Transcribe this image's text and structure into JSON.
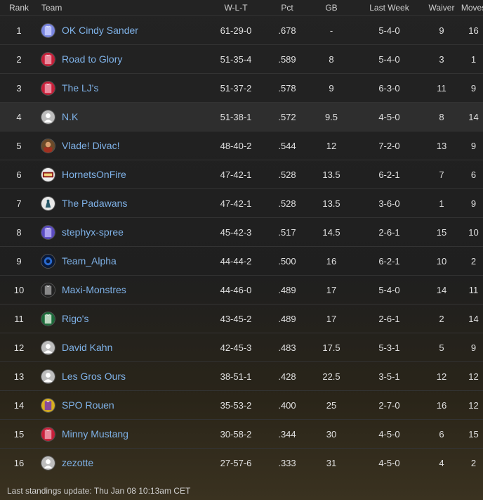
{
  "headers": {
    "rank": "Rank",
    "team": "Team",
    "wlt": "W-L-T",
    "pct": "Pct",
    "gb": "GB",
    "last_week": "Last Week",
    "waiver": "Waiver",
    "moves": "Moves"
  },
  "rows": [
    {
      "rank": "1",
      "team": "OK Cindy Sander",
      "wlt": "61-29-0",
      "pct": ".678",
      "gb": "-",
      "last_week": "5-4-0",
      "waiver": "9",
      "moves": "16",
      "logo": "jersey-blue-icon"
    },
    {
      "rank": "2",
      "team": "Road to Glory",
      "wlt": "51-35-4",
      "pct": ".589",
      "gb": "8",
      "last_week": "5-4-0",
      "waiver": "3",
      "moves": "1",
      "logo": "jersey-red-icon"
    },
    {
      "rank": "3",
      "team": "The LJ's",
      "wlt": "51-37-2",
      "pct": ".578",
      "gb": "9",
      "last_week": "6-3-0",
      "waiver": "11",
      "moves": "9",
      "logo": "jersey-red-icon"
    },
    {
      "rank": "4",
      "team": "N.K",
      "wlt": "51-38-1",
      "pct": ".572",
      "gb": "9.5",
      "last_week": "4-5-0",
      "waiver": "8",
      "moves": "14",
      "logo": "default-avatar-icon"
    },
    {
      "rank": "5",
      "team": "Vlade! Divac!",
      "wlt": "48-40-2",
      "pct": ".544",
      "gb": "12",
      "last_week": "7-2-0",
      "waiver": "13",
      "moves": "9",
      "logo": "photo-avatar-icon"
    },
    {
      "rank": "6",
      "team": "HornetsOnFire",
      "wlt": "47-42-1",
      "pct": ".528",
      "gb": "13.5",
      "last_week": "6-2-1",
      "waiver": "7",
      "moves": "6",
      "logo": "team-logo-icon"
    },
    {
      "rank": "7",
      "team": "The Padawans",
      "wlt": "47-42-1",
      "pct": ".528",
      "gb": "13.5",
      "last_week": "3-6-0",
      "waiver": "1",
      "moves": "9",
      "logo": "padawan-logo-icon"
    },
    {
      "rank": "8",
      "team": "stephyx-spree",
      "wlt": "45-42-3",
      "pct": ".517",
      "gb": "14.5",
      "last_week": "2-6-1",
      "waiver": "15",
      "moves": "10",
      "logo": "jersey-purple-icon"
    },
    {
      "rank": "9",
      "team": "Team_Alpha",
      "wlt": "44-44-2",
      "pct": ".500",
      "gb": "16",
      "last_week": "6-2-1",
      "waiver": "10",
      "moves": "2",
      "logo": "alpha-logo-icon"
    },
    {
      "rank": "10",
      "team": "Maxi-Monstres",
      "wlt": "44-46-0",
      "pct": ".489",
      "gb": "17",
      "last_week": "5-4-0",
      "waiver": "14",
      "moves": "11",
      "logo": "jersey-black-icon"
    },
    {
      "rank": "11",
      "team": "Rigo's",
      "wlt": "43-45-2",
      "pct": ".489",
      "gb": "17",
      "last_week": "2-6-1",
      "waiver": "2",
      "moves": "14",
      "logo": "jersey-green-icon"
    },
    {
      "rank": "12",
      "team": "David Kahn",
      "wlt": "42-45-3",
      "pct": ".483",
      "gb": "17.5",
      "last_week": "5-3-1",
      "waiver": "5",
      "moves": "9",
      "logo": "default-avatar-icon"
    },
    {
      "rank": "13",
      "team": "Les Gros Ours",
      "wlt": "38-51-1",
      "pct": ".428",
      "gb": "22.5",
      "last_week": "3-5-1",
      "waiver": "12",
      "moves": "12",
      "logo": "default-avatar-icon"
    },
    {
      "rank": "14",
      "team": "SPO Rouen",
      "wlt": "35-53-2",
      "pct": ".400",
      "gb": "25",
      "last_week": "2-7-0",
      "waiver": "16",
      "moves": "12",
      "logo": "jersey-yellow-icon"
    },
    {
      "rank": "15",
      "team": "Minny Mustang",
      "wlt": "30-58-2",
      "pct": ".344",
      "gb": "30",
      "last_week": "4-5-0",
      "waiver": "6",
      "moves": "15",
      "logo": "jersey-red-icon"
    },
    {
      "rank": "16",
      "team": "zezotte",
      "wlt": "27-57-6",
      "pct": ".333",
      "gb": "31",
      "last_week": "4-5-0",
      "waiver": "4",
      "moves": "2",
      "logo": "default-avatar-icon"
    }
  ],
  "highlight_rank": "4",
  "footer": "Last standings update: Thu Jan 08 10:13am CET",
  "colors": {
    "link": "#7fb2e8",
    "text": "#e0e0e0",
    "header_text": "#cfcfcf",
    "row_border": "#333333",
    "highlight_row": "#2e2e2e"
  }
}
